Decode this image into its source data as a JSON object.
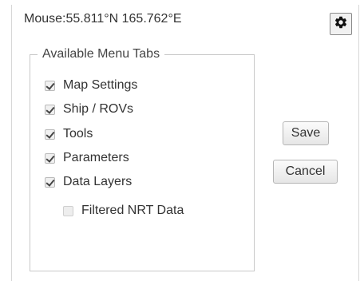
{
  "header": {
    "mouse_label": "Mouse:",
    "mouse_coords": "55.811°N 165.762°E",
    "settings_icon": "gear-icon"
  },
  "menu_tabs": {
    "legend": "Available Menu Tabs",
    "items": [
      {
        "label": "Map Settings",
        "checked": true,
        "enabled": true
      },
      {
        "label": "Ship / ROVs",
        "checked": true,
        "enabled": true
      },
      {
        "label": "Tools",
        "checked": true,
        "enabled": true
      },
      {
        "label": "Parameters",
        "checked": true,
        "enabled": true
      },
      {
        "label": "Data Layers",
        "checked": true,
        "enabled": true
      },
      {
        "label": "Filtered NRT Data",
        "checked": false,
        "enabled": false
      }
    ]
  },
  "actions": {
    "save_label": "Save",
    "cancel_label": "Cancel"
  }
}
